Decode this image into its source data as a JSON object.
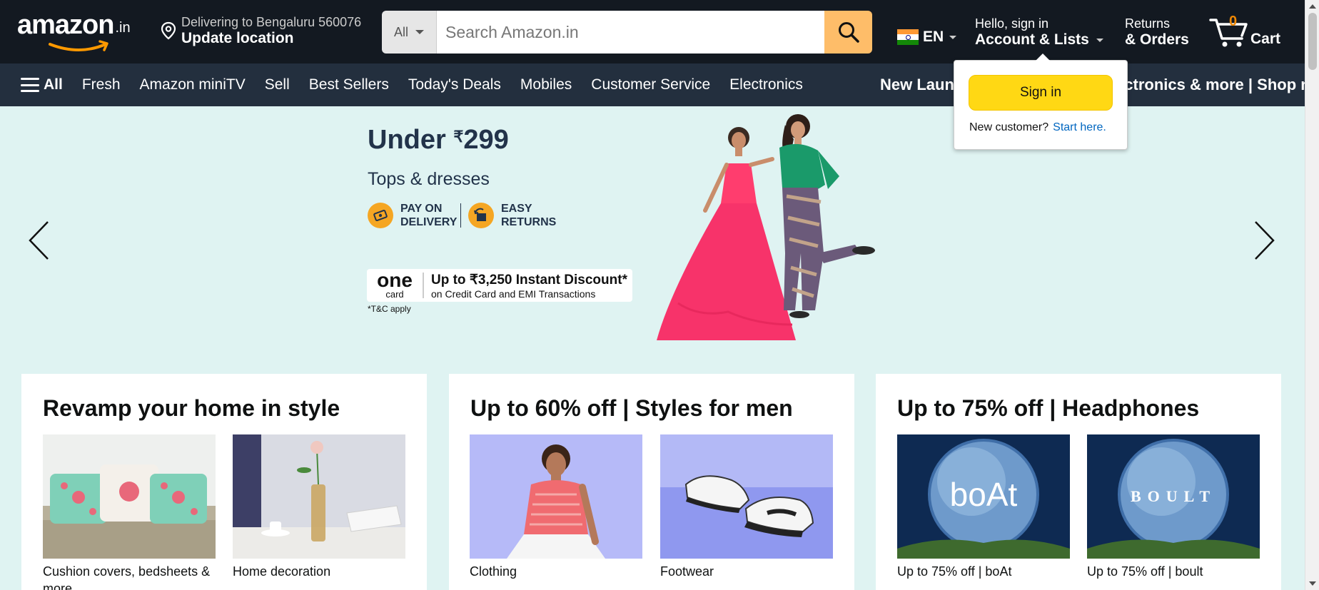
{
  "header": {
    "logo_text": "amazon",
    "logo_tld": ".in",
    "deliver_line1": "Delivering to Bengaluru 560076",
    "deliver_line2": "Update location",
    "search_category": "All",
    "search_placeholder": "Search Amazon.in",
    "language": "EN",
    "account_line1": "Hello, sign in",
    "account_line2": "Account & Lists",
    "returns_line1": "Returns",
    "returns_line2": "& Orders",
    "cart_count": "0",
    "cart_label": "Cart"
  },
  "subnav": {
    "all_label": "All",
    "items": [
      "Fresh",
      "Amazon miniTV",
      "Sell",
      "Best Sellers",
      "Today's Deals",
      "Mobiles",
      "Customer Service",
      "Electronics"
    ],
    "promo": "New Launches from Mobiles, Electronics & more | Shop now"
  },
  "signin_popup": {
    "button": "Sign in",
    "new_customer": "New customer?",
    "start_here": "Start here."
  },
  "hero": {
    "title_prefix": "Under ",
    "currency": "₹",
    "price": "299",
    "subtitle": "Tops & dresses",
    "badge1": "PAY ON DELIVERY",
    "badge2": "EASY RETURNS",
    "card_brand": "one",
    "card_brand_sub": "card",
    "offer_line1": "Up to ₹3,250 Instant Discount*",
    "offer_line2": "on Credit Card and EMI Transactions",
    "tc": "*T&C apply"
  },
  "cards": [
    {
      "title": "Revamp your home in style",
      "tiles": [
        {
          "caption": "Cushion covers, bedsheets & more"
        },
        {
          "caption": "Home decoration"
        }
      ]
    },
    {
      "title": "Up to 60% off | Styles for men",
      "tiles": [
        {
          "caption": "Clothing"
        },
        {
          "caption": "Footwear"
        }
      ]
    },
    {
      "title": "Up to 75% off | Headphones",
      "tiles": [
        {
          "caption": "Up to 75% off | boAt",
          "logo": "boAt"
        },
        {
          "caption": "Up to 75% off | boult",
          "logo": "BOULT"
        }
      ]
    }
  ],
  "colors": {
    "nav_bg": "#131921",
    "subnav_bg": "#232f3e",
    "search_button": "#febd69",
    "signin_button": "#ffd814",
    "hero_bg": "#dff3f2",
    "link": "#0066c0"
  }
}
